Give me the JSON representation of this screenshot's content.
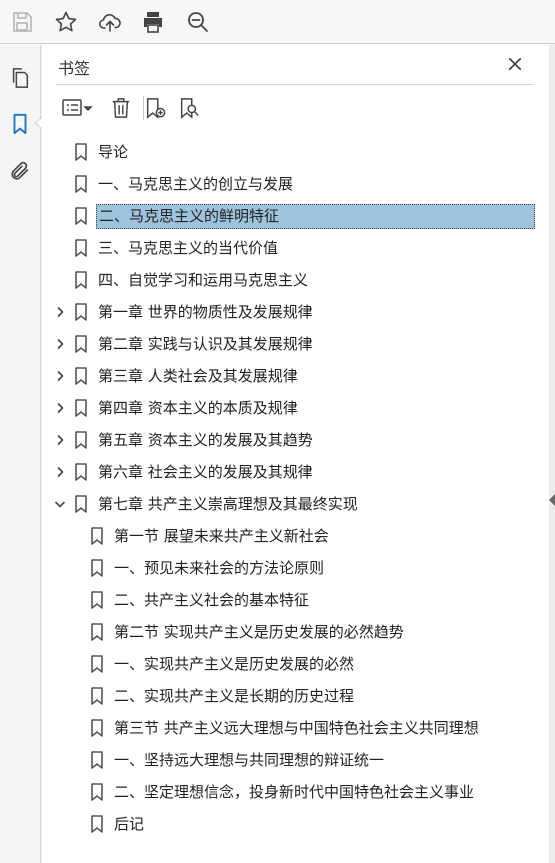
{
  "toolbar": {
    "icons": [
      "save-icon",
      "star-icon",
      "upload-icon",
      "print-icon",
      "zoom-search-icon"
    ]
  },
  "rail": {
    "icons": [
      "pages-icon",
      "bookmark-icon",
      "attachment-icon"
    ],
    "active": "bookmark-icon"
  },
  "panel": {
    "title": "书签",
    "tools": [
      "options-menu-icon",
      "delete-icon",
      "new-bookmark-icon",
      "bookmark-search-icon"
    ]
  },
  "bookmarks": [
    {
      "label": "导论",
      "level": 0,
      "expandable": false
    },
    {
      "label": "一、马克思主义的创立与发展",
      "level": 0,
      "expandable": false
    },
    {
      "label": "二、马克思主义的鲜明特征",
      "level": 0,
      "expandable": false,
      "selected": true
    },
    {
      "label": "三、马克思主义的当代价值",
      "level": 0,
      "expandable": false
    },
    {
      "label": "四、自觉学习和运用马克思主义",
      "level": 0,
      "expandable": false
    },
    {
      "label": "第一章  世界的物质性及发展规律",
      "level": 0,
      "expandable": true,
      "expanded": false
    },
    {
      "label": "第二章  实践与认识及其发展规律",
      "level": 0,
      "expandable": true,
      "expanded": false
    },
    {
      "label": "第三章  人类社会及其发展规律",
      "level": 0,
      "expandable": true,
      "expanded": false
    },
    {
      "label": "第四章  资本主义的本质及规律",
      "level": 0,
      "expandable": true,
      "expanded": false
    },
    {
      "label": "第五章  资本主义的发展及其趋势",
      "level": 0,
      "expandable": true,
      "expanded": false
    },
    {
      "label": "第六章  社会主义的发展及其规律",
      "level": 0,
      "expandable": true,
      "expanded": false
    },
    {
      "label": "第七章  共产主义崇高理想及其最终实现",
      "level": 0,
      "expandable": true,
      "expanded": true
    },
    {
      "label": "第一节  展望未来共产主义新社会",
      "level": 1,
      "expandable": false
    },
    {
      "label": "一、预见未来社会的方法论原则",
      "level": 1,
      "expandable": false
    },
    {
      "label": "二、共产主义社会的基本特征",
      "level": 1,
      "expandable": false
    },
    {
      "label": "第二节  实现共产主义是历史发展的必然趋势",
      "level": 1,
      "expandable": false
    },
    {
      "label": "一、实现共产主义是历史发展的必然",
      "level": 1,
      "expandable": false
    },
    {
      "label": "二、实现共产主义是长期的历史过程",
      "level": 1,
      "expandable": false
    },
    {
      "label": "第三节  共产主义远大理想与中国特色社会主义共同理想",
      "level": 1,
      "expandable": false
    },
    {
      "label": "一、坚持远大理想与共同理想的辩证统一",
      "level": 1,
      "expandable": false
    },
    {
      "label": "二、坚定理想信念，投身新时代中国特色社会主义事业",
      "level": 1,
      "expandable": false
    },
    {
      "label": "后记",
      "level": 1,
      "expandable": false
    }
  ],
  "colors": {
    "selection": "#9dc3dd",
    "accent": "#1a73c9"
  }
}
